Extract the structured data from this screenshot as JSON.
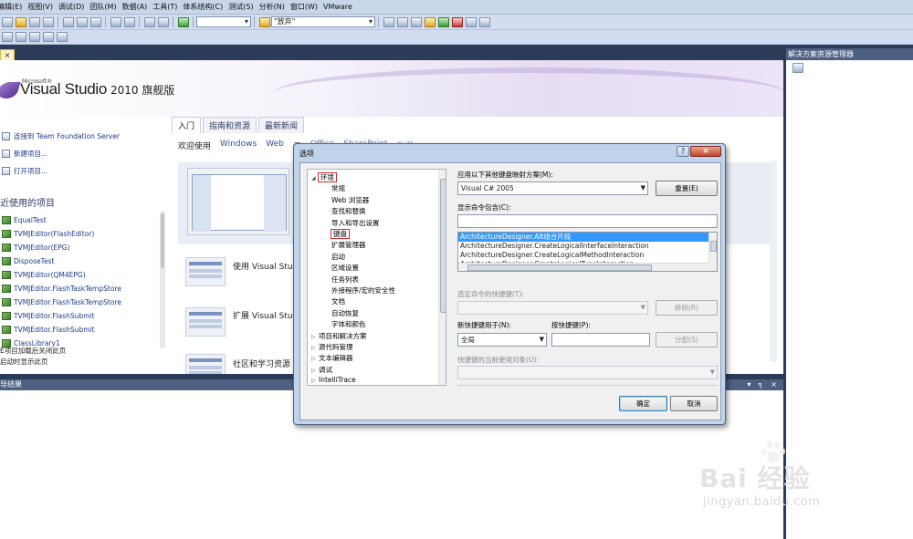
{
  "menu": [
    "编辑(E)",
    "视图(V)",
    "调试(D)",
    "团队(M)",
    "数据(A)",
    "工具(T)",
    "体系结构(C)",
    "测试(S)",
    "分析(N)",
    "窗口(W)",
    "VMware"
  ],
  "toolbar": {
    "config_combo": "",
    "find_combo": "\"放弃\""
  },
  "right_panel": {
    "title": "解决方案资源管理器"
  },
  "start_page": {
    "doc_tab_close": "×",
    "logo_small": "Microsoft®",
    "logo_name": "Visual Studio",
    "logo_edition": "2010 旗舰版",
    "links": [
      "连接到 Team Foundation Server",
      "新建项目...",
      "打开项目..."
    ],
    "recent_title": "近使用的项目",
    "recent": [
      "EqualTest",
      "TVMJEditor(FlashEditor)",
      "TVMJEditor(EPG)",
      "DisposeTest",
      "TVMJEditor(QM4EPG)",
      "TVMJEditor.FlashTaskTempStore",
      "TVMJEditor.FlashTaskTempStore",
      "TVMJEditor.FlashSubmit",
      "TVMJEditor.FlashSubmit",
      "ClassLibrary1"
    ],
    "check1": "E项目加载后关闭此页",
    "check2": "启动时显示此页",
    "tabs": [
      "入门",
      "指南和资源",
      "最新新闻"
    ],
    "subtabs": [
      "欢迎使用",
      "Windows",
      "Web",
      "云",
      "Office",
      "SharePoint",
      "数据"
    ],
    "items": [
      "使用 Visual Stud",
      "扩展 Visual Stud",
      "社区和学习资源"
    ]
  },
  "output": {
    "title": "导结果",
    "buttons": "▾ ╕ ×"
  },
  "dialog": {
    "title": "选项",
    "help": "?",
    "close": "×",
    "tree": [
      {
        "label": "环境",
        "arrow": "◢",
        "selected": true,
        "indent": 0
      },
      {
        "label": "常规",
        "indent": 1
      },
      {
        "label": "Web 浏览器",
        "indent": 1
      },
      {
        "label": "查找和替换",
        "indent": 1
      },
      {
        "label": "导入和导出设置",
        "indent": 1
      },
      {
        "label": "键盘",
        "indent": 1,
        "selected": true
      },
      {
        "label": "扩展管理器",
        "indent": 1
      },
      {
        "label": "启动",
        "indent": 1
      },
      {
        "label": "区域设置",
        "indent": 1
      },
      {
        "label": "任务列表",
        "indent": 1
      },
      {
        "label": "外接程序/宏的安全性",
        "indent": 1
      },
      {
        "label": "文档",
        "indent": 1
      },
      {
        "label": "自动恢复",
        "indent": 1
      },
      {
        "label": "字体和颜色",
        "indent": 1
      },
      {
        "label": "项目和解决方案",
        "arrow": "▷",
        "indent": 0
      },
      {
        "label": "源代码管理",
        "arrow": "▷",
        "indent": 0
      },
      {
        "label": "文本编辑器",
        "arrow": "▷",
        "indent": 0
      },
      {
        "label": "调试",
        "arrow": "▷",
        "indent": 0
      },
      {
        "label": "IntelliTrace",
        "arrow": "▷",
        "indent": 0
      }
    ],
    "mapping_label": "应用以下其他键盘映射方案(M):",
    "mapping_value": "Visual C# 2005",
    "reset_button": "重置(E)",
    "show_commands_label": "显示命令包含(C):",
    "show_commands_value": "",
    "commands": [
      "ArchitectureDesigner.Alt组合片段",
      "ArchitectureDesigner.CreateLogicalInterfaceInteraction",
      "ArchitectureDesigner.CreateLogicalMethodInteraction",
      "ArchitectureDesigner.CreateLogicalTypeInteraction"
    ],
    "selected_shortcut_label": "选定命令的快捷键(T):",
    "remove_button": "移除(R)",
    "use_new_label": "新快捷键用于(N):",
    "use_new_value": "全局",
    "press_keys_label": "按快捷键(P):",
    "assign_button": "分配(S)",
    "currently_used_label": "快捷键的当前使用对象(U):",
    "ok_button": "确定",
    "cancel_button": "取消"
  },
  "watermark": {
    "logo": "Bai  经验",
    "url": "jingyan.baidu.com"
  }
}
